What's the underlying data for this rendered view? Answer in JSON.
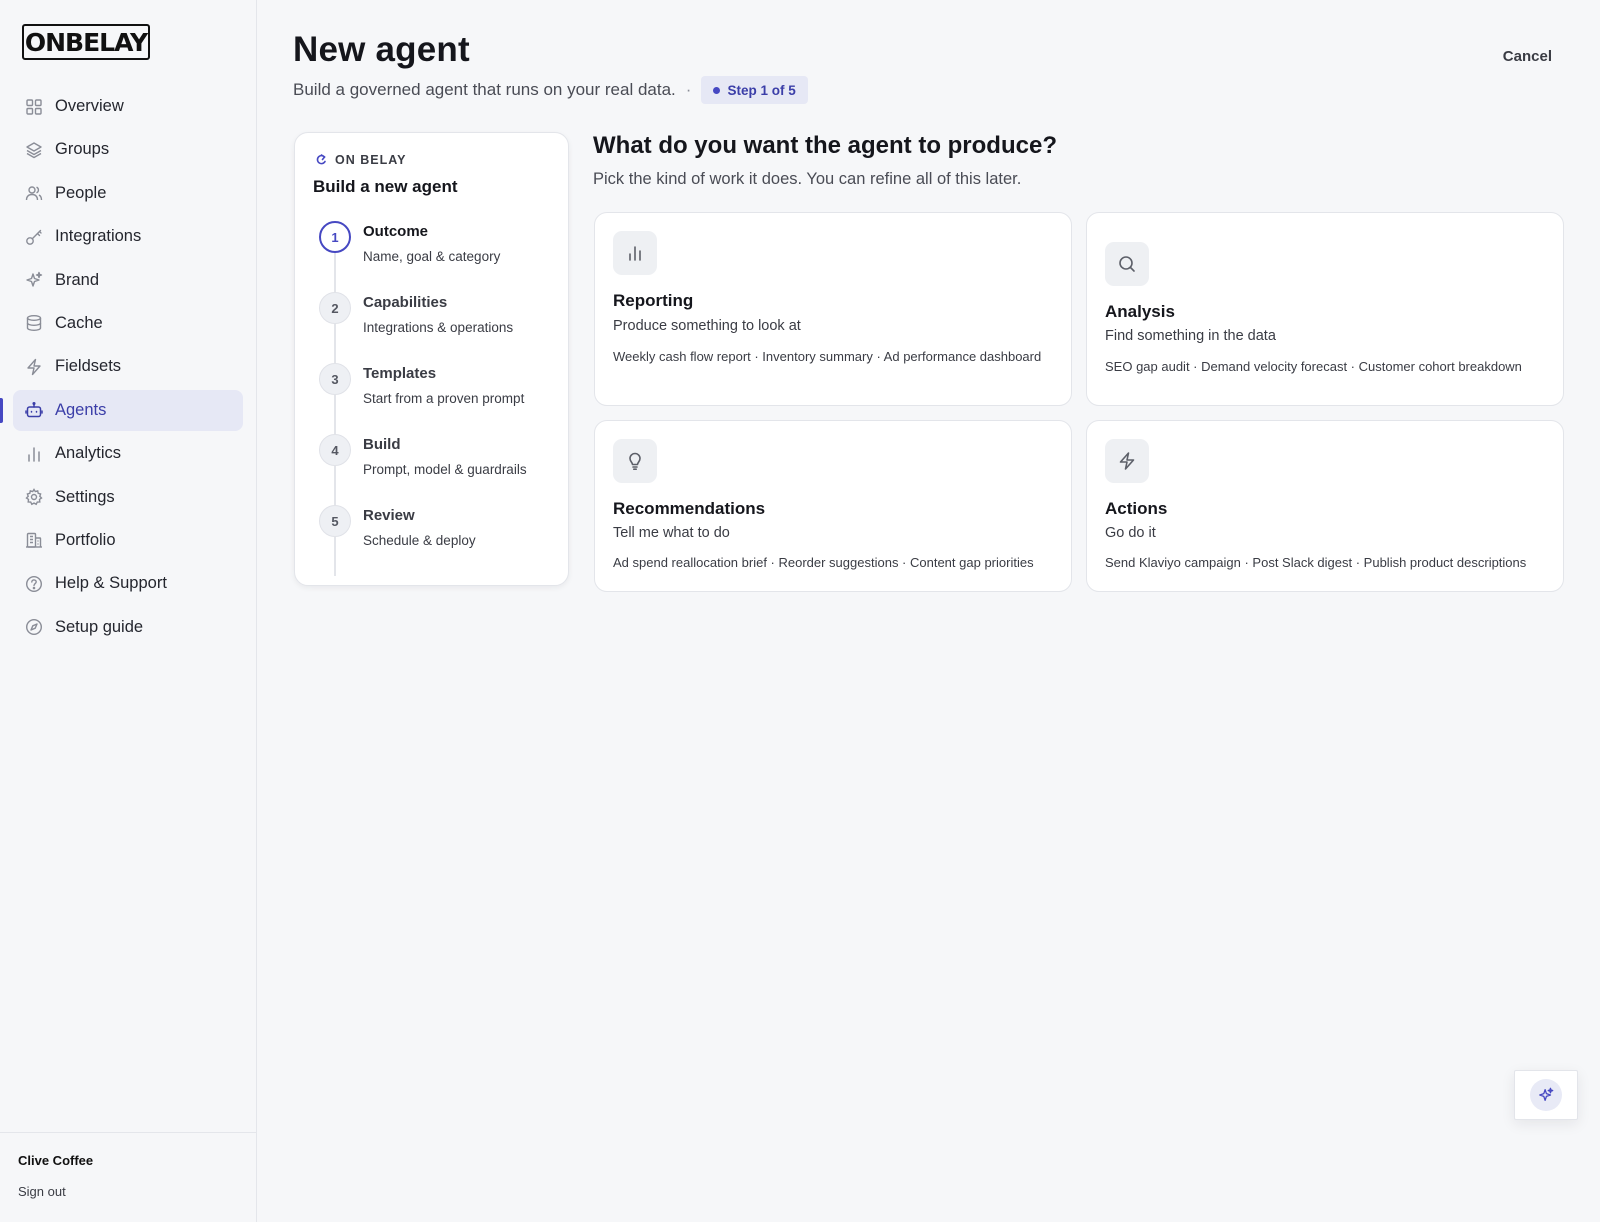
{
  "brand": {
    "logo_text": "ONBELAY"
  },
  "sidebar": {
    "items": [
      {
        "label": "Overview",
        "icon": "grid-icon"
      },
      {
        "label": "Groups",
        "icon": "layers-icon"
      },
      {
        "label": "People",
        "icon": "users-icon"
      },
      {
        "label": "Integrations",
        "icon": "key-icon"
      },
      {
        "label": "Brand",
        "icon": "sparkles-icon"
      },
      {
        "label": "Cache",
        "icon": "database-icon"
      },
      {
        "label": "Fieldsets",
        "icon": "bolt-icon"
      },
      {
        "label": "Agents",
        "icon": "robot-icon",
        "active": true
      },
      {
        "label": "Analytics",
        "icon": "bar-chart-icon"
      },
      {
        "label": "Settings",
        "icon": "gear-icon"
      },
      {
        "label": "Portfolio",
        "icon": "building-icon"
      },
      {
        "label": "Help & Support",
        "icon": "help-circle-icon"
      },
      {
        "label": "Setup guide",
        "icon": "compass-icon"
      }
    ],
    "org_name": "Clive Coffee",
    "signout_label": "Sign out"
  },
  "header": {
    "title": "New agent",
    "subtitle": "Build a governed agent that runs on your real data.",
    "separator": "·",
    "step_badge": "Step 1 of 5",
    "cancel_label": "Cancel"
  },
  "stepper": {
    "eyebrow": "ON BELAY",
    "title": "Build a new agent",
    "steps": [
      {
        "num": "1",
        "label": "Outcome",
        "desc": "Name, goal & category",
        "active": true
      },
      {
        "num": "2",
        "label": "Capabilities",
        "desc": "Integrations & operations"
      },
      {
        "num": "3",
        "label": "Templates",
        "desc": "Start from a proven prompt"
      },
      {
        "num": "4",
        "label": "Build",
        "desc": "Prompt, model & guardrails"
      },
      {
        "num": "5",
        "label": "Review",
        "desc": "Schedule & deploy"
      }
    ]
  },
  "main": {
    "question": "What do you want the agent to produce?",
    "question_sub": "Pick the kind of work it does. You can refine all of this later.",
    "options": [
      {
        "title": "Reporting",
        "subtitle": "Produce something to look at",
        "examples": "Weekly cash flow report · Inventory summary · Ad performance dashboard",
        "icon": "bar-chart-icon"
      },
      {
        "title": "Analysis",
        "subtitle": "Find something in the data",
        "examples": "SEO gap audit · Demand velocity forecast · Customer cohort breakdown",
        "icon": "search-icon"
      },
      {
        "title": "Recommendations",
        "subtitle": "Tell me what to do",
        "examples": "Ad spend reallocation brief · Reorder suggestions · Content gap priorities",
        "icon": "lightbulb-icon"
      },
      {
        "title": "Actions",
        "subtitle": "Go do it",
        "examples": "Send Klaviyo campaign · Post Slack digest · Publish product descriptions",
        "icon": "bolt-icon"
      }
    ]
  },
  "assistant": {
    "icon": "sparkles-icon"
  },
  "colors": {
    "accent": "#4648c2",
    "active_bg": "#e6e8f5",
    "page_bg": "#f6f7f9"
  }
}
